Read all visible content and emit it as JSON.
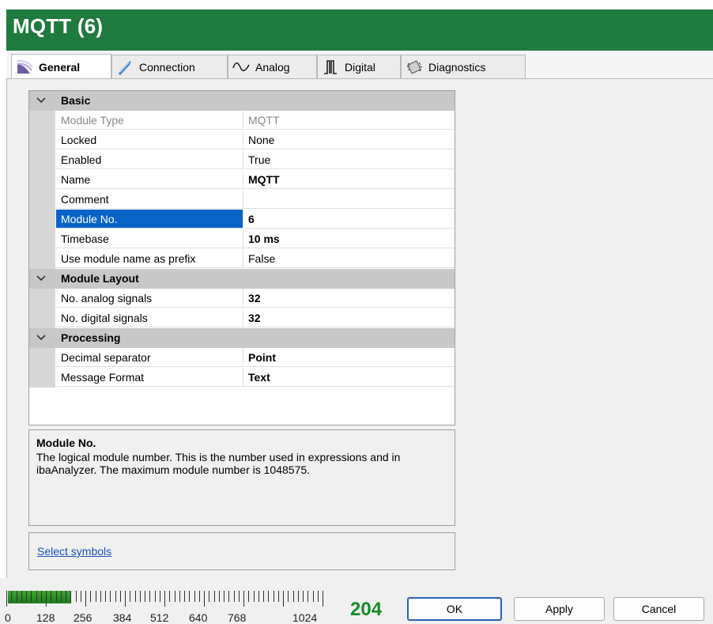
{
  "window": {
    "title": "MQTT (6)"
  },
  "tabs": [
    {
      "label": "General",
      "icon": "general-icon",
      "active": true
    },
    {
      "label": "Connection",
      "icon": "connection-icon",
      "active": false
    },
    {
      "label": "Analog",
      "icon": "analog-wave-icon",
      "active": false
    },
    {
      "label": "Digital",
      "icon": "digital-pulse-icon",
      "active": false
    },
    {
      "label": "Diagnostics",
      "icon": "chip-icon",
      "active": false
    }
  ],
  "grid": {
    "categories": [
      {
        "title": "Basic",
        "rows": [
          {
            "name": "Module Type",
            "value": "MQTT",
            "readonly": true
          },
          {
            "name": "Locked",
            "value": "None"
          },
          {
            "name": "Enabled",
            "value": "True"
          },
          {
            "name": "Name",
            "value": "MQTT",
            "bold": true
          },
          {
            "name": "Comment",
            "value": ""
          },
          {
            "name": "Module No.",
            "value": "6",
            "bold": true,
            "selected": true
          },
          {
            "name": "Timebase",
            "value": "10 ms",
            "bold": true
          },
          {
            "name": "Use module name as prefix",
            "value": "False"
          }
        ]
      },
      {
        "title": "Module Layout",
        "rows": [
          {
            "name": "No. analog signals",
            "value": "32",
            "bold": true
          },
          {
            "name": "No. digital signals",
            "value": "32",
            "bold": true
          }
        ]
      },
      {
        "title": "Processing",
        "rows": [
          {
            "name": "Decimal separator",
            "value": "Point",
            "bold": true
          },
          {
            "name": "Message Format",
            "value": "Text",
            "bold": true
          }
        ]
      }
    ]
  },
  "help": {
    "title": "Module No.",
    "description": "The logical module number. This is the number used in expressions and in ibaAnalyzer. The maximum module number is 1048575."
  },
  "links": {
    "select_symbols": "Select symbols"
  },
  "signal_usage": {
    "scale_labels": [
      "0",
      "128",
      "256",
      "384",
      "512",
      "640",
      "768",
      "1024"
    ],
    "used": 204,
    "max": 1024,
    "value_text": "204"
  },
  "buttons": {
    "ok": "OK",
    "apply": "Apply",
    "cancel": "Cancel"
  },
  "colors": {
    "titlebar": "#1f7a3f",
    "selection": "#0a64c8",
    "usage_value": "#1a8a2a",
    "link": "#1a4fbf"
  }
}
